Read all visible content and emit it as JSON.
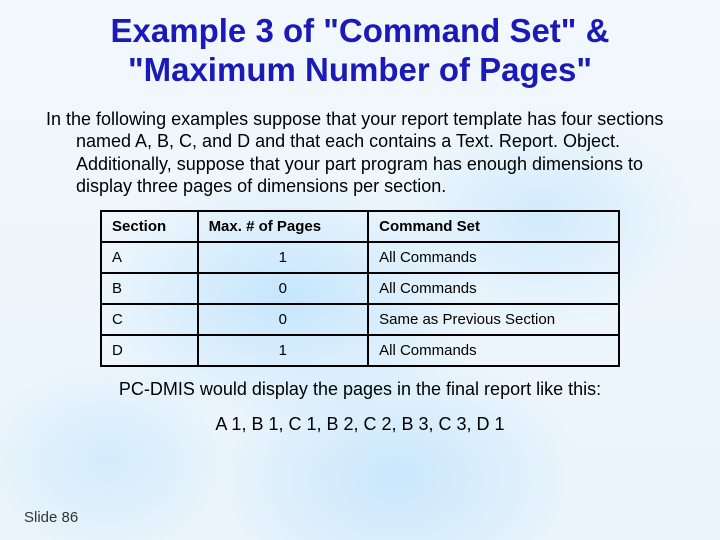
{
  "title": "Example 3 of \"Command Set\" & \"Maximum Number of Pages\"",
  "intro": "In the following examples suppose that your report template has four sections named A, B, C, and D and that each contains a Text. Report. Object. Additionally, suppose that your part program has enough dimensions to display three pages of dimensions per section.",
  "table": {
    "headers": {
      "section": "Section",
      "maxPages": "Max. # of Pages",
      "commandSet": "Command Set"
    },
    "rows": [
      {
        "section": "A",
        "maxPages": "1",
        "commandSet": "All Commands"
      },
      {
        "section": "B",
        "maxPages": "0",
        "commandSet": "All Commands"
      },
      {
        "section": "C",
        "maxPages": "0",
        "commandSet": "Same as Previous Section"
      },
      {
        "section": "D",
        "maxPages": "1",
        "commandSet": "All Commands"
      }
    ]
  },
  "resultIntro": "PC-DMIS would display the pages in the final report like this:",
  "resultLine": "A 1, B 1, C 1, B 2, C 2, B 3, C 3, D 1",
  "footer": "Slide 86"
}
